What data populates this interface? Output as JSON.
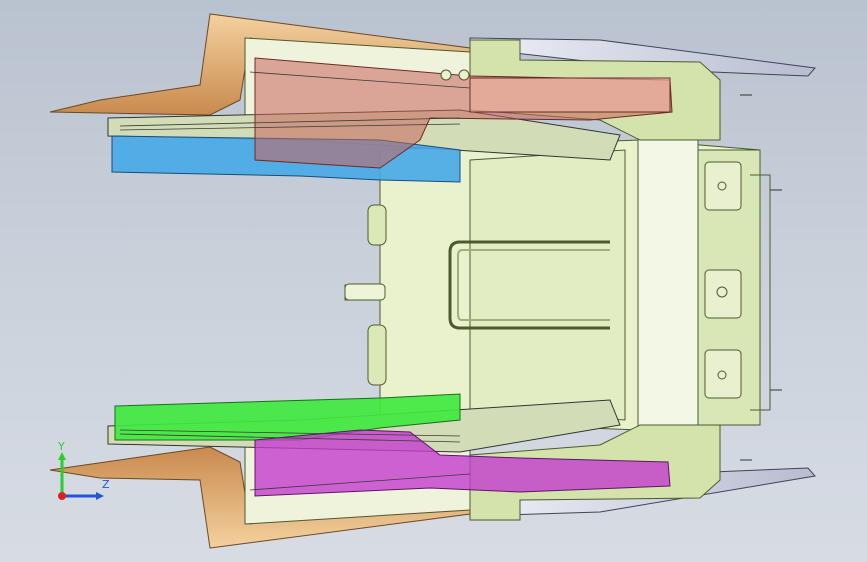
{
  "viewport": {
    "background_top": "#b9c2cf",
    "background_bottom": "#d7dce4"
  },
  "model": {
    "parts": [
      {
        "name": "main-frame",
        "color": "#e6f0c8"
      },
      {
        "name": "side-brackets",
        "color": "#c8dca4"
      },
      {
        "name": "upper-trim-panel",
        "color": "#e8b88a"
      },
      {
        "name": "lower-trim-panel",
        "color": "#e8b88a"
      },
      {
        "name": "red-transparent-part",
        "color": "#d2786e"
      },
      {
        "name": "blue-part",
        "color": "#44a6e6"
      },
      {
        "name": "green-part",
        "color": "#3ee63e"
      },
      {
        "name": "magenta-part",
        "color": "#c43ccf"
      },
      {
        "name": "top-plate",
        "color": "#d8dae8"
      }
    ]
  },
  "triad": {
    "y_label": "Y",
    "z_label": "Z",
    "y_color": "#2ecc2e",
    "z_color": "#2255dd",
    "x_color": "#e02020"
  }
}
